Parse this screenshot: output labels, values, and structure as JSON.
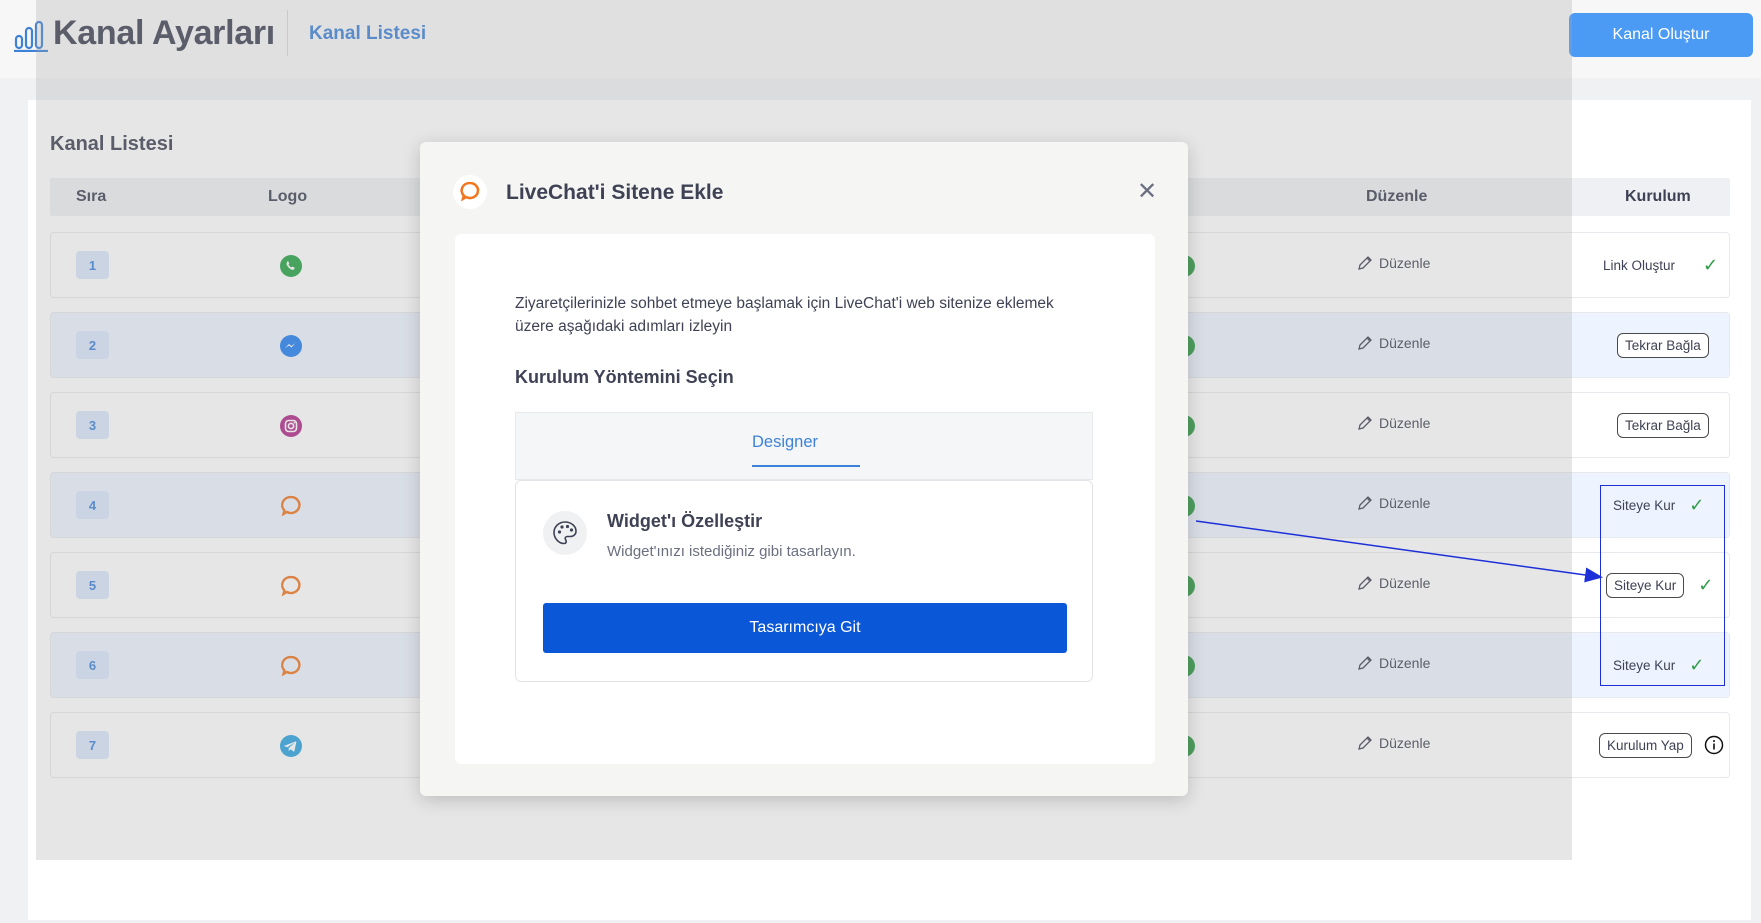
{
  "header": {
    "title": "Kanal Ayarları",
    "breadcrumb": "Kanal Listesi",
    "create_button": "Kanal Oluştur"
  },
  "list": {
    "title": "Kanal Listesi",
    "columns": {
      "sira": "Sıra",
      "logo": "Logo",
      "duzenle": "Düzenle",
      "kurulum": "Kurulum"
    },
    "rows": [
      {
        "num": "1",
        "logo": "whatsapp-icon",
        "edit": "Düzenle",
        "install": "Link Oluştur",
        "install_style": "text",
        "status": "check"
      },
      {
        "num": "2",
        "logo": "messenger-icon",
        "edit": "Düzenle",
        "install": "Tekrar Bağla",
        "install_style": "button",
        "status": "none"
      },
      {
        "num": "3",
        "logo": "instagram-icon",
        "edit": "Düzenle",
        "install": "Tekrar Bağla",
        "install_style": "button",
        "status": "none"
      },
      {
        "num": "4",
        "logo": "livechat-icon",
        "edit": "Düzenle",
        "install": "Siteye Kur",
        "install_style": "text",
        "status": "check"
      },
      {
        "num": "5",
        "logo": "livechat-icon",
        "edit": "Düzenle",
        "install": "Siteye Kur",
        "install_style": "button",
        "status": "check"
      },
      {
        "num": "6",
        "logo": "livechat-icon",
        "edit": "Düzenle",
        "install": "Siteye Kur",
        "install_style": "text",
        "status": "check"
      },
      {
        "num": "7",
        "logo": "telegram-icon",
        "edit": "Düzenle",
        "install": "Kurulum Yap",
        "install_style": "button",
        "status": "info"
      }
    ]
  },
  "modal": {
    "title": "LiveChat'i Sitene Ekle",
    "intro": "Ziyaretçilerinizle sohbet etmeye başlamak için LiveChat'i web sitenize eklemek üzere aşağıdaki adımları izleyin",
    "section_title": "Kurulum Yöntemini Seçin",
    "tab": "Designer",
    "option_title": "Widget'ı Özelleştir",
    "option_desc": "Widget'ınızı istediğiniz gibi tasarlayın.",
    "button": "Tasarımcıya Git"
  },
  "colors": {
    "accent": "#3d82d8",
    "primary_button": "#0a58d8",
    "create_button": "#4b9bf5",
    "success": "#2e9b45",
    "livechat": "#f07620",
    "annotation": "#1d2fd8"
  }
}
